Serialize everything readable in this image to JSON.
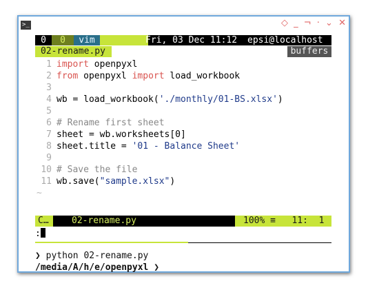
{
  "window": {
    "controls": [
      "◇",
      "_",
      "¬",
      "·",
      "⌄",
      "✕"
    ]
  },
  "tabline": {
    "tab0": "0",
    "tab0b": "0",
    "mode": "vim",
    "datetime": "Fri, 03 Dec 11:12",
    "user": "epsi@localhost"
  },
  "bufferline": {
    "active_buffer": "02-rename.py",
    "buffers_label": "buffers"
  },
  "code": {
    "lines": [
      {
        "n": "1",
        "text": "import openpyxl"
      },
      {
        "n": "2",
        "text": "from openpyxl import load_workbook"
      },
      {
        "n": "3",
        "text": ""
      },
      {
        "n": "4",
        "text": "wb = load_workbook('./monthly/01-BS.xlsx')"
      },
      {
        "n": "5",
        "text": ""
      },
      {
        "n": "6",
        "text": "# Rename first sheet"
      },
      {
        "n": "7",
        "text": "sheet = wb.worksheets[0]"
      },
      {
        "n": "8",
        "text": "sheet.title = '01 - Balance Sheet'"
      },
      {
        "n": "9",
        "text": ""
      },
      {
        "n": "10",
        "text": "# Save the file"
      },
      {
        "n": "11",
        "text": "wb.save(\"sample.xlsx\")"
      }
    ],
    "tilde": "~"
  },
  "statusline": {
    "mode": "C…",
    "file": "02-rename.py",
    "percent": "100%",
    "symbol": "≡",
    "line": "11:",
    "col": "1"
  },
  "cmdline": {
    "text": ":"
  },
  "shell": {
    "command_prompt": "❯ python 02-rename.py",
    "cwd_prefix": "/media/A/h/e/",
    "cwd_last": "openpyxl",
    "cwd_suffix": " ❯"
  },
  "colors": {
    "accent_green": "#c7e43a",
    "frame_blue": "#6fa8dc",
    "keyword_red": "#d9534f"
  }
}
